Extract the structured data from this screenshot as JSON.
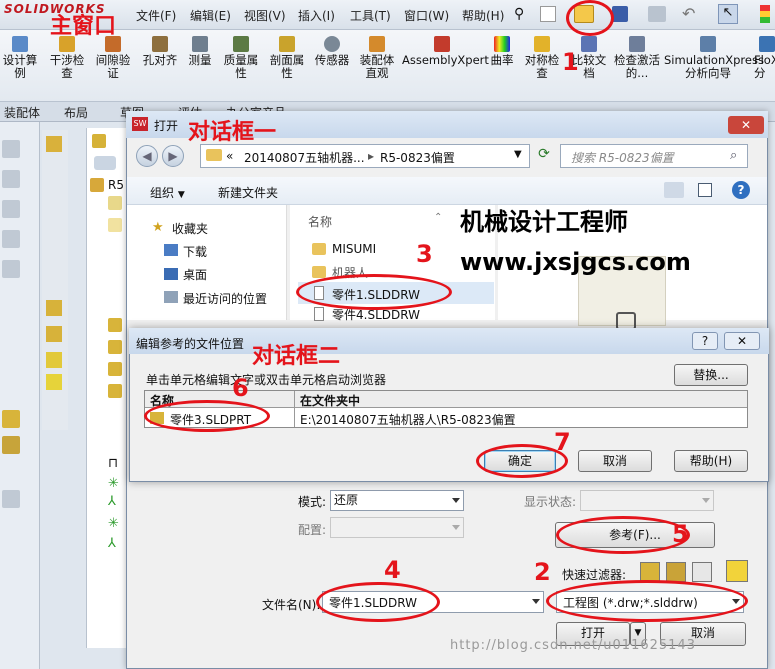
{
  "app": {
    "logo_text": "SOLIDWORKS"
  },
  "menu": [
    "文件(F)",
    "编辑(E)",
    "视图(V)",
    "插入(I)",
    "工具(T)",
    "窗口(W)",
    "帮助(H)"
  ],
  "ribbon": [
    "设计算例",
    "干涉检查",
    "间隙验证",
    "孔对齐",
    "测量",
    "质量属性",
    "剖面属性",
    "传感器",
    "装配体直观",
    "AssemblyXpert",
    "曲率",
    "对称检查",
    "比较文档",
    "检查激活的...",
    "SimulationXpress 分析向导",
    "FloX 分"
  ],
  "tabs": [
    "装配体",
    "布局",
    "草图",
    "评估",
    "办公室产品"
  ],
  "tree": {
    "root_label": "R5"
  },
  "open_dialog": {
    "title": "打开",
    "path": [
      "«",
      "20140807五轴机器...",
      "R5-0823偏置"
    ],
    "search_placeholder": "搜索 R5-0823偏置",
    "organize": "组织",
    "new_folder": "新建文件夹",
    "nav": [
      "收藏夹",
      "下载",
      "桌面",
      "最近访问的位置"
    ],
    "column_name": "名称",
    "files": [
      "MISUMI",
      "机器人",
      "零件1.SLDDRW",
      "零件4.SLDDRW"
    ],
    "mode_label": "模式:",
    "mode_value": "还原",
    "display_state_label": "显示状态:",
    "config_label": "配置:",
    "reference_button": "参考(F)...",
    "quick_filter_label": "快速过滤器:",
    "filename_label": "文件名(N):",
    "filename_value": "零件1.SLDDRW",
    "filetype_value": "工程图 (*.drw;*.slddrw)",
    "open_button": "打开",
    "cancel_button": "取消"
  },
  "ref_dialog": {
    "title": "编辑参考的文件位置",
    "instruction": "单击单元格编辑文字或双击单元格启动浏览器",
    "replace_button": "替换...",
    "col_name": "名称",
    "col_folder": "在文件夹中",
    "row_name": "零件3.SLDPRT",
    "row_folder": "E:\\20140807五轴机器人\\R5-0823偏置",
    "ok_button": "确定",
    "cancel_button": "取消",
    "help_button": "帮助(H)"
  },
  "annotations": {
    "main_window": "主窗口",
    "dialog1": "对话框一",
    "dialog2": "对话框二",
    "n1": "1",
    "n2": "2",
    "n3": "3",
    "n4": "4",
    "n5": "5",
    "n6": "6",
    "n7": "7"
  },
  "watermark": {
    "line1": "机械设计工程师",
    "line2": "www.jxsjgcs.com",
    "footer": "http://blog.csdn.net/u011625143"
  },
  "colors": {
    "accent_red": "#e4141b"
  }
}
